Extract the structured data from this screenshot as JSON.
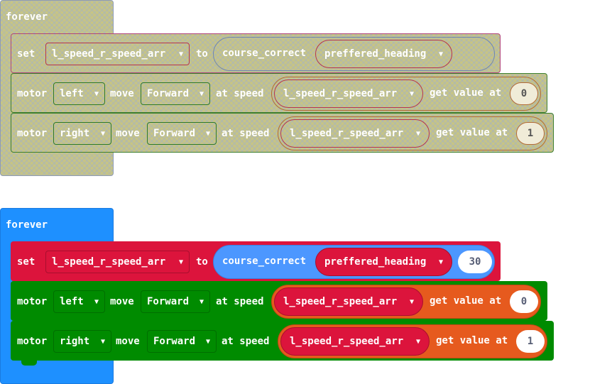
{
  "keywords": {
    "forever": "forever",
    "set": "set",
    "to": "to",
    "motor": "motor",
    "move": "move",
    "at_speed": "at speed",
    "get_value_at": "get value at"
  },
  "disabled_group": {
    "set_block": {
      "variable": "l_speed_r_speed_arr",
      "function": "course_correct",
      "argument": "preffered_heading"
    },
    "motor1": {
      "side": "left",
      "direction": "Forward",
      "speed_var": "l_speed_r_speed_arr",
      "index": "0"
    },
    "motor2": {
      "side": "right",
      "direction": "Forward",
      "speed_var": "l_speed_r_speed_arr",
      "index": "1"
    }
  },
  "enabled_group": {
    "set_block": {
      "variable": "l_speed_r_speed_arr",
      "function": "course_correct",
      "argument": "preffered_heading",
      "extra_value": "30"
    },
    "motor1": {
      "side": "left",
      "direction": "Forward",
      "speed_var": "l_speed_r_speed_arr",
      "index": "0"
    },
    "motor2": {
      "side": "right",
      "direction": "Forward",
      "speed_var": "l_speed_r_speed_arr",
      "index": "1"
    }
  },
  "colors": {
    "loop_blue": "#1e90ff",
    "variables_red": "#dc143c",
    "function_blue": "#4c97ff",
    "motor_green": "#008b00",
    "array_orange": "#e65a1e",
    "disabled_fill": "#c6c486"
  }
}
